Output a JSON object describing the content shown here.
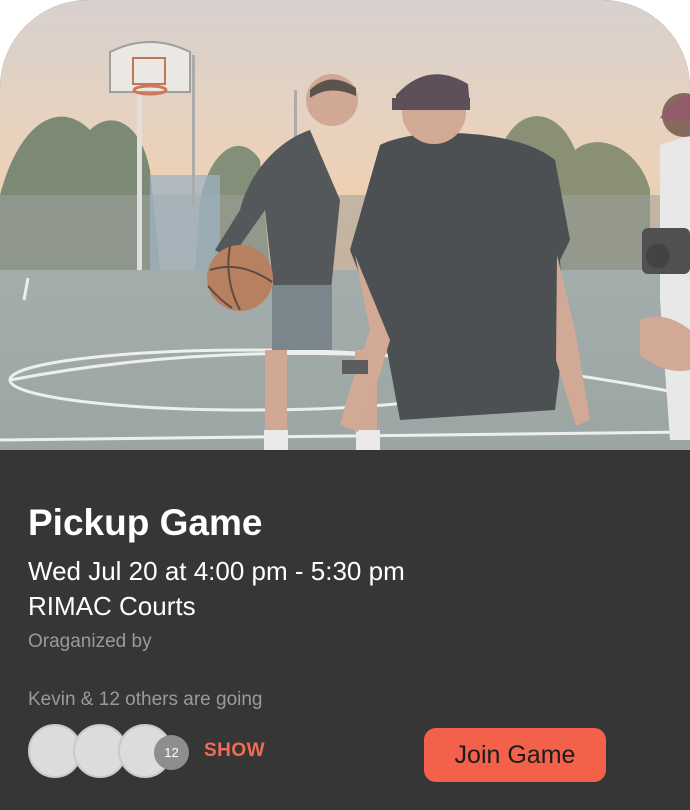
{
  "event": {
    "title": "Pickup Game",
    "datetime": "Wed Jul 20 at 4:00 pm - 5:30 pm",
    "location": "RIMAC Courts",
    "organizer_label": "Oraganized by"
  },
  "attendees": {
    "summary": "Kevin & 12 others are going",
    "extra_count": "12",
    "show_label": "SHOW"
  },
  "actions": {
    "join_label": "Join Game"
  },
  "colors": {
    "card_background": "#363636",
    "accent": "#f4614a",
    "primary_text": "#ffffff",
    "secondary_text": "#9a9a9a"
  },
  "icons": {
    "hero": "basketball-court-photo"
  }
}
